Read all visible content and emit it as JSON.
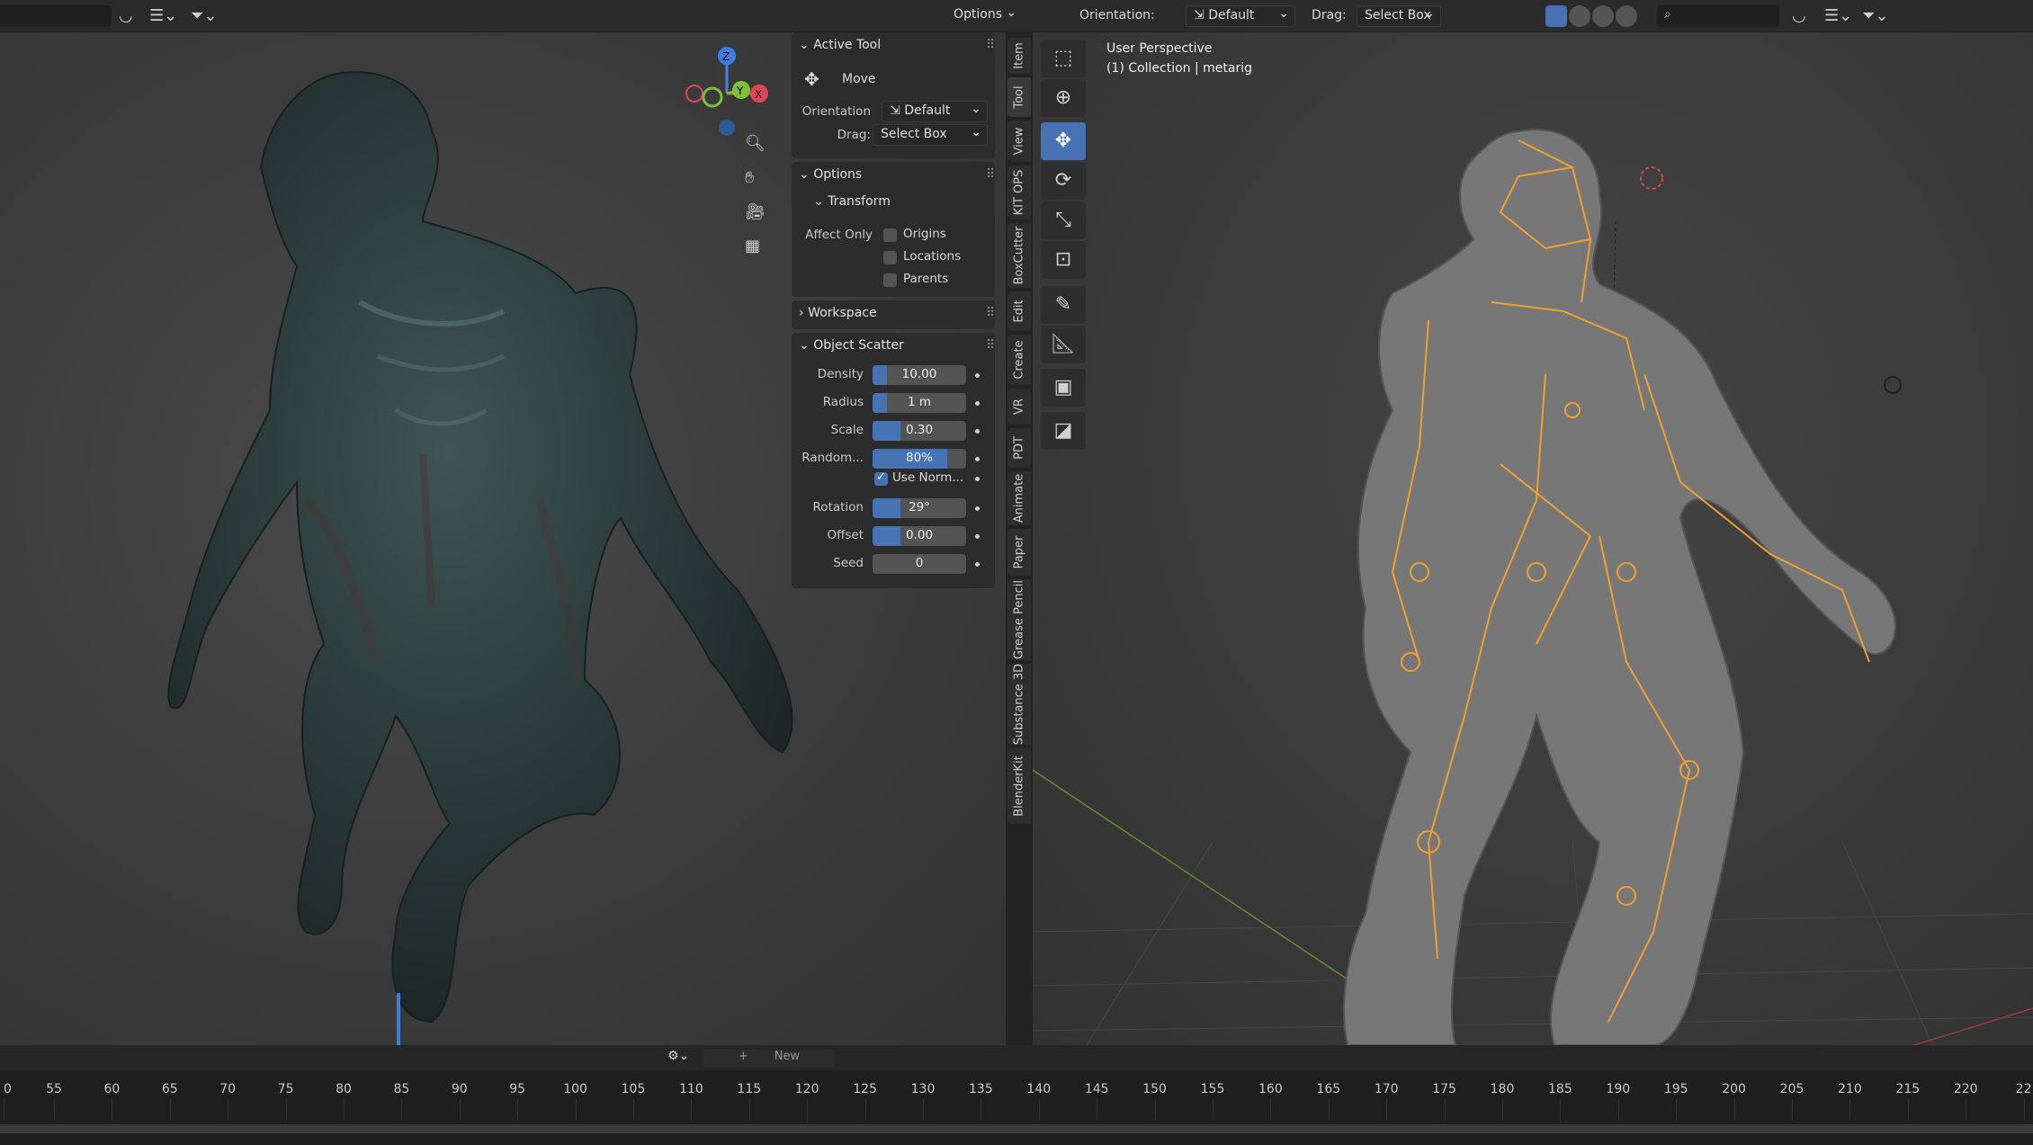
{
  "left_header": {
    "options_label": "Options"
  },
  "right_header": {
    "orientation_label": "Orientation:",
    "orientation_value": "Default",
    "drag_label": "Drag:",
    "drag_value": "Select Box"
  },
  "viewport_info": {
    "perspective": "User Perspective",
    "collection": "(1) Collection | metarig"
  },
  "gizmo": {
    "z": "Z",
    "y": "Y",
    "x": "X"
  },
  "npanel": {
    "active_tool": {
      "title": "Active Tool",
      "tool_name": "Move",
      "orientation_label": "Orientation",
      "orientation_value": "Default",
      "drag_label": "Drag:",
      "drag_value": "Select Box"
    },
    "options": {
      "title": "Options",
      "transform_title": "Transform",
      "affect_only_label": "Affect Only",
      "checks": [
        {
          "label": "Origins",
          "checked": false
        },
        {
          "label": "Locations",
          "checked": false
        },
        {
          "label": "Parents",
          "checked": false
        }
      ]
    },
    "workspace": {
      "title": "Workspace"
    },
    "object_scatter": {
      "title": "Object Scatter",
      "fields": [
        {
          "label": "Density",
          "value": "10.00",
          "fill": 0.15
        },
        {
          "label": "Radius",
          "value": "1 m",
          "fill": 0.15
        },
        {
          "label": "Scale",
          "value": "0.30",
          "fill": 0.3
        },
        {
          "label": "Random...",
          "value": "80%",
          "fill": 0.8
        }
      ],
      "use_normals": {
        "label": "Use Norm...",
        "checked": true
      },
      "fields2": [
        {
          "label": "Rotation",
          "value": "29°",
          "fill": 0.3
        },
        {
          "label": "Offset",
          "value": "0.00",
          "fill": 0.3
        },
        {
          "label": "Seed",
          "value": "0",
          "fill": 0.0
        }
      ]
    }
  },
  "side_tabs": [
    "Item",
    "Tool",
    "View",
    "KIT OPS",
    "BoxCutter",
    "Edit",
    "Create",
    "VR",
    "PDT",
    "Animate",
    "Paper",
    "Grease Pencil",
    "Substance 3D",
    "BlenderKit"
  ],
  "tools": [
    "select-box-icon",
    "cursor-icon",
    "move-icon",
    "rotate-icon",
    "scale-icon",
    "transform-icon",
    "annotate-icon",
    "measure-icon",
    "add-cube-icon",
    "extra-icon"
  ],
  "timeline": {
    "new_label": "New",
    "frames": [
      "0",
      "55",
      "60",
      "65",
      "70",
      "75",
      "80",
      "85",
      "90",
      "95",
      "100",
      "105",
      "110",
      "115",
      "120",
      "125",
      "130",
      "135",
      "140",
      "145",
      "150",
      "155",
      "160",
      "165",
      "170",
      "175",
      "180",
      "185",
      "190",
      "195",
      "200",
      "205",
      "210",
      "215",
      "220",
      "22"
    ]
  }
}
